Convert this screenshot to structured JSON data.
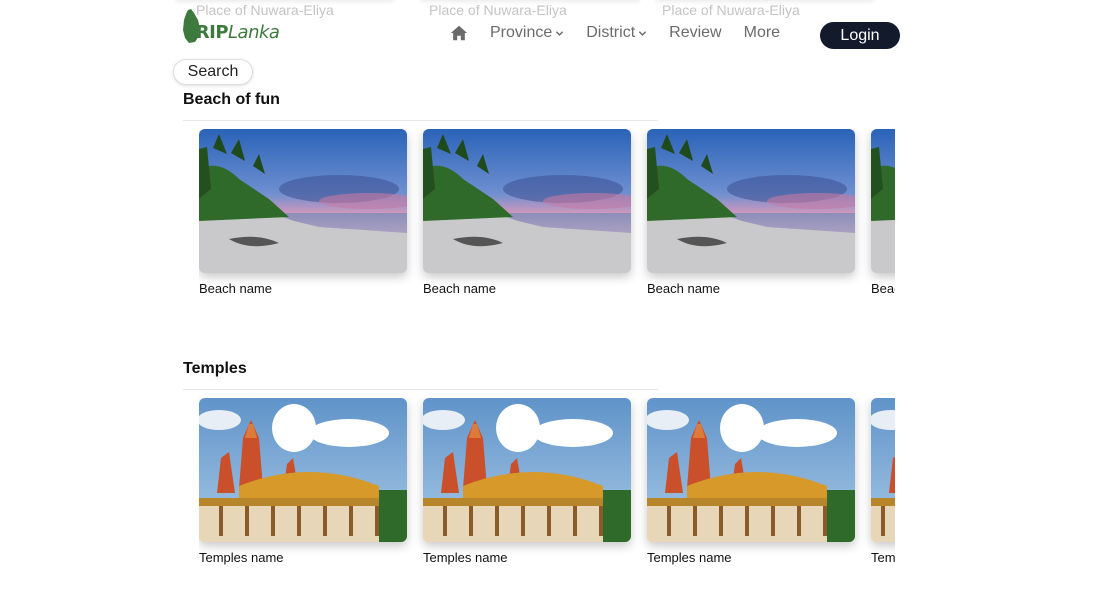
{
  "top_captions": [
    "Place of Nuwara-Eliya",
    "Place of Nuwara-Eliya",
    "Place of Nuwara-Eliya"
  ],
  "logo": {
    "part1": "TRIP",
    "part2": "Lanka"
  },
  "nav": {
    "items": [
      {
        "label": "Province",
        "has_dropdown": true
      },
      {
        "label": "District",
        "has_dropdown": true
      },
      {
        "label": "Review",
        "has_dropdown": false
      },
      {
        "label": "More",
        "has_dropdown": false
      }
    ],
    "login_label": "Login"
  },
  "search_label": "Search",
  "sections": [
    {
      "title": "Beach of fun",
      "card_label": "Beach name",
      "image": "beach-image",
      "cards": [
        "Beach name",
        "Beach name",
        "Beach name",
        "Beach name"
      ]
    },
    {
      "title": "Temples",
      "card_label": "Temples name",
      "image": "temple-image",
      "cards": [
        "Temples name",
        "Temples name",
        "Temples name",
        "Temples name"
      ]
    }
  ],
  "colors": {
    "login_bg": "#121a2b",
    "logo_green": "#3d7a3d"
  }
}
